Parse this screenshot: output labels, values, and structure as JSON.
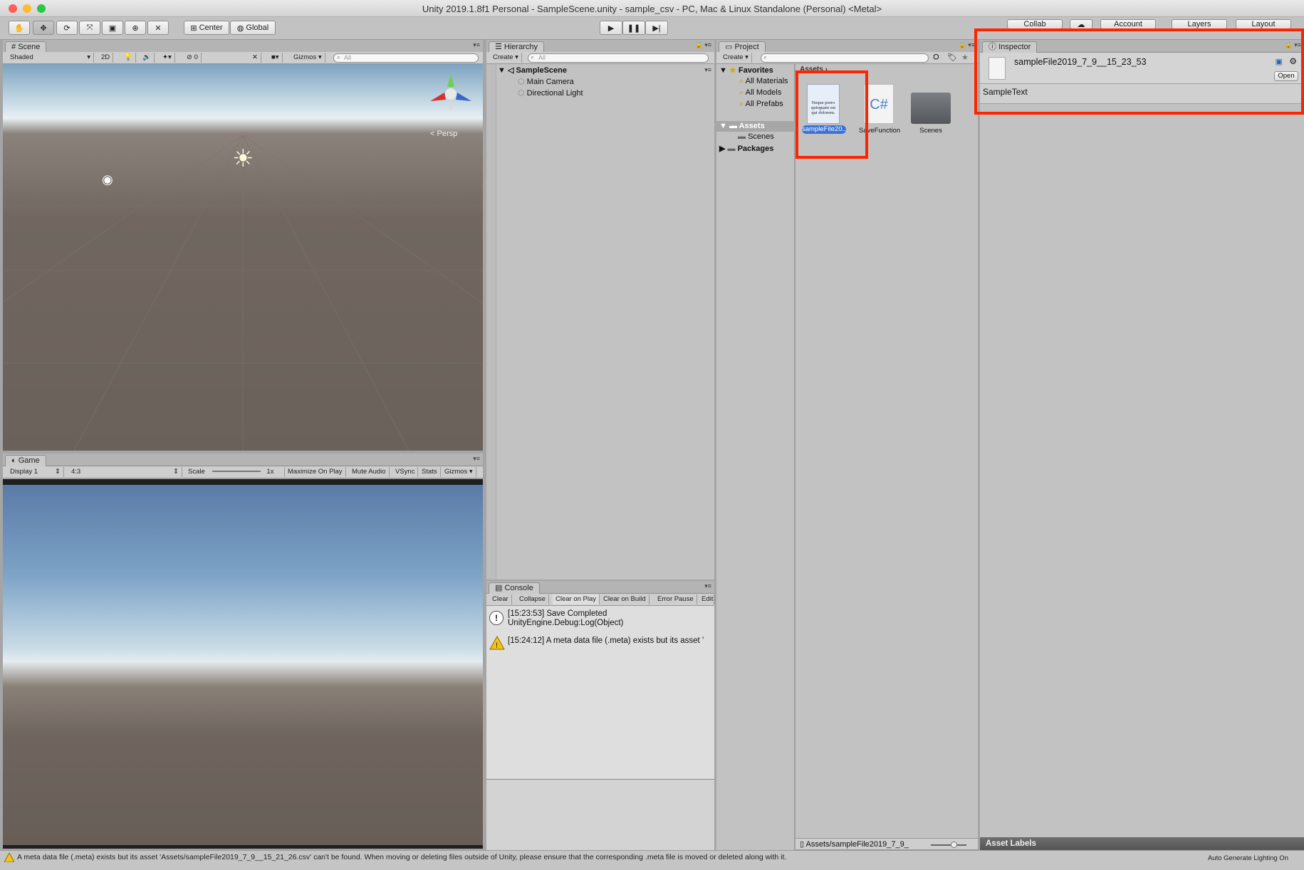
{
  "window": {
    "title": "Unity 2019.1.8f1 Personal - SampleScene.unity - sample_csv - PC, Mac & Linux Standalone (Personal) <Metal>"
  },
  "toolbar": {
    "pivot": "Center",
    "space": "Global",
    "collab": "Collab",
    "account": "Account",
    "layers": "Layers",
    "layout": "Layout"
  },
  "scene": {
    "tab": "Scene",
    "shading": "Shaded",
    "mode2d": "2D",
    "hidden_count": "0",
    "gizmos": "Gizmos",
    "search": "All",
    "persp": "Persp"
  },
  "game": {
    "tab": "Game",
    "display": "Display 1",
    "aspect": "4:3",
    "scale_label": "Scale",
    "scale_value": "1x",
    "buttons": [
      "Maximize On Play",
      "Mute Audio",
      "VSync",
      "Stats",
      "Gizmos"
    ]
  },
  "hierarchy": {
    "tab": "Hierarchy",
    "create": "Create",
    "search": "All",
    "scene_name": "SampleScene",
    "items": [
      "Main Camera",
      "Directional Light"
    ]
  },
  "console": {
    "tab": "Console",
    "buttons": [
      "Clear",
      "Collapse",
      "Clear on Play",
      "Clear on Build",
      "Error Pause",
      "Edit"
    ],
    "entries": [
      {
        "icon": "info-icon",
        "line1": "[15:23:53] Save Completed",
        "line2": "UnityEngine.Debug:Log(Object)"
      },
      {
        "icon": "warning-icon",
        "line1": "[15:24:12] A meta data file (.meta) exists but its asset '",
        "line2": ""
      }
    ]
  },
  "project": {
    "tab": "Project",
    "create": "Create",
    "favorites_label": "Favorites",
    "favorites": [
      "All Materials",
      "All Models",
      "All Prefabs"
    ],
    "assets_label": "Assets",
    "asset_children": [
      "Scenes"
    ],
    "packages_label": "Packages",
    "breadcrumb": "Assets",
    "assets": [
      {
        "name": "sampleFile20...",
        "icon": "text-file-icon",
        "preview": "Neque porro quisquam est qui dolorem."
      },
      {
        "name": "SaveFunction",
        "icon": "csharp-script-icon",
        "preview": "C#"
      },
      {
        "name": "Scenes",
        "icon": "folder-icon",
        "preview": ""
      }
    ],
    "footer_path": "Assets/sampleFile2019_7_9_"
  },
  "inspector": {
    "tab": "Inspector",
    "file_name": "sampleFile2019_7_9__15_23_53",
    "open_button": "Open",
    "content": "SampleText",
    "asset_labels": "Asset Labels"
  },
  "status": {
    "message": "A meta data file (.meta) exists but its asset 'Assets/sampleFile2019_7_9__15_21_26.csv' can't be found. When moving or deleting files outside of Unity, please ensure that the corresponding .meta file is moved or deleted along with it.",
    "lighting": "Auto Generate Lighting On"
  },
  "colors": {
    "highlight": "#ff2400",
    "selection": "#3a72d8",
    "sky": "#8fb2cf",
    "ground": "#6b615b"
  }
}
